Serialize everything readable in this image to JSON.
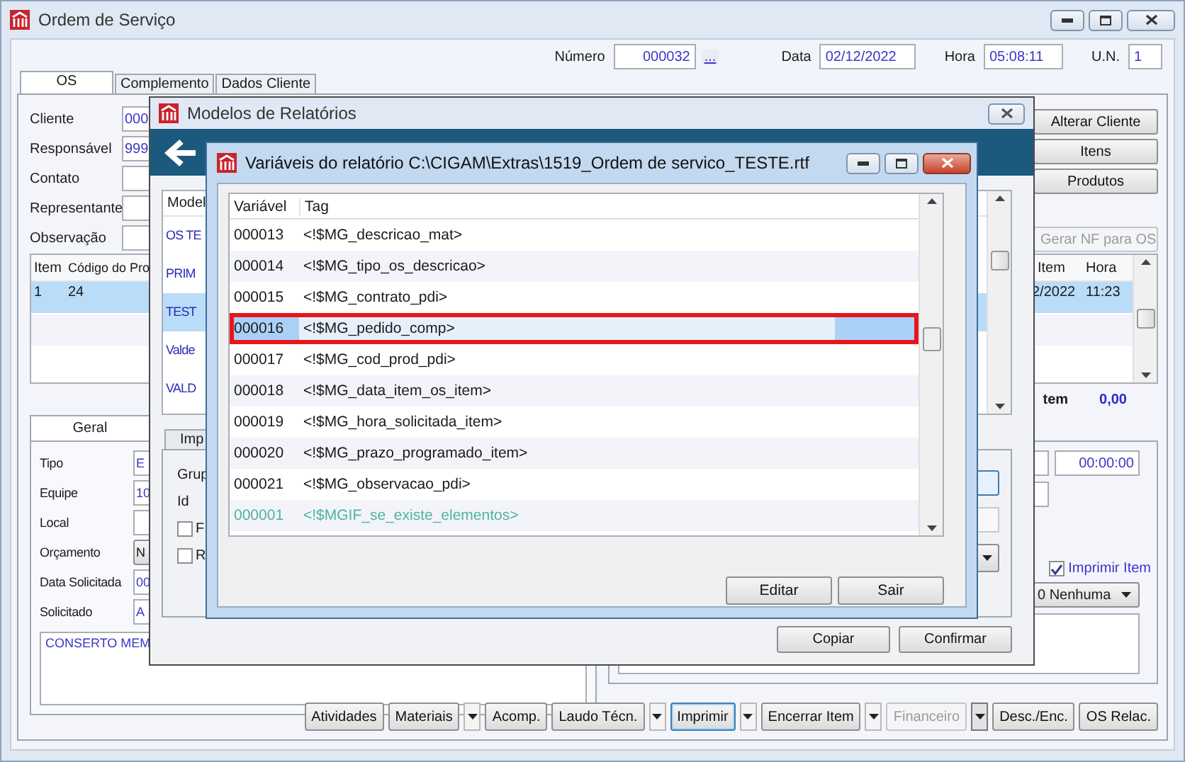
{
  "window": {
    "title": "Ordem de Serviço"
  },
  "header_fields": [
    {
      "label": "Número",
      "value": "000032",
      "kind": "number",
      "lookup": "..."
    },
    {
      "label": "Data",
      "value": "02/12/2022",
      "kind": "text"
    },
    {
      "label": "Hora",
      "value": "05:08:11",
      "kind": "text"
    },
    {
      "label": "U.N.",
      "value": "1",
      "kind": "text"
    }
  ],
  "tabs": [
    {
      "label": "OS",
      "selected": true
    },
    {
      "label": "Complemento",
      "selected": false
    },
    {
      "label": "Dados Cliente",
      "selected": false
    }
  ],
  "form": [
    {
      "label": "Cliente",
      "value": "000"
    },
    {
      "label": "Responsável",
      "value": "999"
    },
    {
      "label": "Contato"
    },
    {
      "label": "Representante"
    },
    {
      "label": "Observação"
    }
  ],
  "side_buttons": [
    {
      "label": "Alterar Cliente",
      "disabled": false
    },
    {
      "label": "Itens",
      "disabled": false
    },
    {
      "label": "Produtos",
      "disabled": false
    },
    {
      "label": "Gerar NF para OS",
      "disabled": true
    }
  ],
  "items_grid": {
    "columns": [
      "Item",
      "Código do Pro"
    ],
    "right_columns": [
      "Item",
      "Hora"
    ],
    "rows": [
      {
        "cells": [
          "1",
          "24"
        ],
        "right_cells": [
          "2/2022",
          "11:23"
        ],
        "selected": true
      }
    ]
  },
  "total": {
    "label": "tem",
    "value": "0,00"
  },
  "detail_tab": {
    "label": "Geral"
  },
  "detail_form": [
    {
      "label": "Tipo",
      "value": "E"
    },
    {
      "label": "Equipe",
      "value": "10"
    },
    {
      "label": "Local"
    },
    {
      "label": "Orçamento",
      "value": "N",
      "kind": "combo"
    },
    {
      "label": "Data Solicitada",
      "value": "00"
    },
    {
      "label": "Solicitado",
      "value": "A"
    }
  ],
  "memo": "CONSERTO MEM",
  "detail_right": {
    "time": "00:00:00",
    "print_item": {
      "label": "Imprimir Item",
      "checked": true
    },
    "priority": "0 Nenhuma"
  },
  "bottom_buttons": [
    {
      "label": "Atividades",
      "dropdown": false,
      "disabled": false,
      "focused": false
    },
    {
      "label": "Materiais",
      "dropdown": true,
      "disabled": false,
      "focused": false
    },
    {
      "label": "Acomp.",
      "dropdown": false,
      "disabled": false,
      "focused": false
    },
    {
      "label": "Laudo Técn.",
      "dropdown": true,
      "disabled": false,
      "focused": false
    },
    {
      "label": "Imprimir",
      "dropdown": true,
      "disabled": false,
      "focused": true
    },
    {
      "label": "Encerrar Item",
      "dropdown": true,
      "disabled": false,
      "focused": false
    },
    {
      "label": "Financeiro",
      "dropdown": true,
      "disabled": true,
      "focused": false
    },
    {
      "label": "Desc./Enc.",
      "dropdown": false,
      "disabled": false,
      "focused": false
    },
    {
      "label": "OS Relac.",
      "dropdown": false,
      "disabled": false,
      "focused": false
    }
  ],
  "models_dialog": {
    "title": "Modelos de Relatórios",
    "list_header": "Model",
    "items": [
      {
        "label": "OS TE",
        "selected": false
      },
      {
        "label": "PRIM",
        "selected": false
      },
      {
        "label": "TEST",
        "selected": true
      },
      {
        "label": "Valde",
        "selected": false
      },
      {
        "label": "VALD",
        "selected": false
      }
    ],
    "tab": "Imp",
    "labels": [
      "Grup",
      "Id"
    ],
    "checkboxes": [
      {
        "label": "F",
        "checked": false
      },
      {
        "label": "R",
        "checked": false
      }
    ],
    "buttons": [
      "Copiar",
      "Confirmar"
    ]
  },
  "variables_dialog": {
    "title": "Variáveis do relatório C:\\CIGAM\\Extras\\1519_Ordem de servico_TESTE.rtf",
    "columns": [
      "Variável",
      "Tag"
    ],
    "rows": [
      {
        "variable": "000013",
        "tag": "<!$MG_descricao_mat>",
        "kind": "field",
        "selected": false,
        "highlighted": false
      },
      {
        "variable": "000014",
        "tag": "<!$MG_tipo_os_descricao>",
        "kind": "field",
        "selected": false,
        "highlighted": false
      },
      {
        "variable": "000015",
        "tag": "<!$MG_contrato_pdi>",
        "kind": "field",
        "selected": false,
        "highlighted": false
      },
      {
        "variable": "000016",
        "tag": "<!$MG_pedido_comp>",
        "kind": "field",
        "selected": true,
        "highlighted": true
      },
      {
        "variable": "000017",
        "tag": "<!$MG_cod_prod_pdi>",
        "kind": "field",
        "selected": false,
        "highlighted": false
      },
      {
        "variable": "000018",
        "tag": "<!$MG_data_item_os_item>",
        "kind": "field",
        "selected": false,
        "highlighted": false
      },
      {
        "variable": "000019",
        "tag": "<!$MG_hora_solicitada_item>",
        "kind": "field",
        "selected": false,
        "highlighted": false
      },
      {
        "variable": "000020",
        "tag": "<!$MG_prazo_programado_item>",
        "kind": "field",
        "selected": false,
        "highlighted": false
      },
      {
        "variable": "000021",
        "tag": "<!$MG_observacao_pdi>",
        "kind": "field",
        "selected": false,
        "highlighted": false
      },
      {
        "variable": "000001",
        "tag": "<!$MGIF_se_existe_elementos>",
        "kind": "condition",
        "selected": false,
        "highlighted": false
      }
    ],
    "buttons": [
      "Editar",
      "Sair"
    ]
  }
}
